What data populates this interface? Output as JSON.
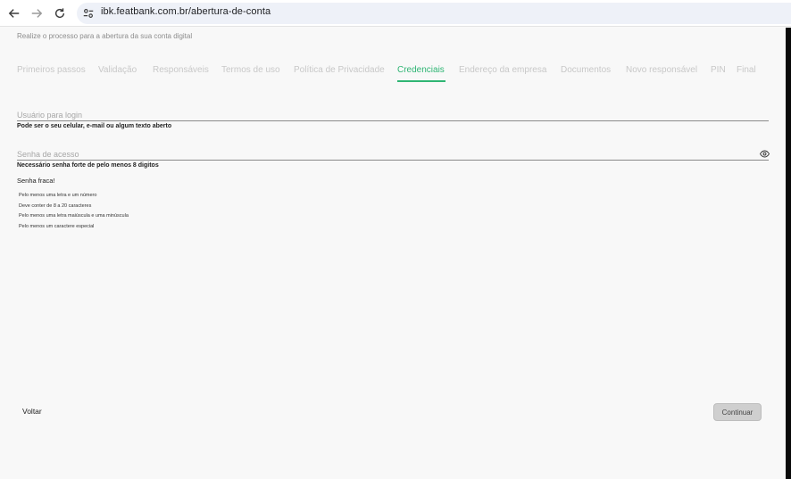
{
  "browser": {
    "url": "ibk.featbank.com.br/abertura-de-conta"
  },
  "page": {
    "subtitle": "Realize o processo para a abertura da sua conta digital"
  },
  "tabs": [
    {
      "label": "Primeiros passos",
      "active": false
    },
    {
      "label": "Validação",
      "active": false
    },
    {
      "label": "Responsáveis",
      "active": false
    },
    {
      "label": "Termos de uso",
      "active": false
    },
    {
      "label": "Política de Privacidade",
      "active": false
    },
    {
      "label": "Credenciais",
      "active": true
    },
    {
      "label": "Endereço da empresa",
      "active": false
    },
    {
      "label": "Documentos",
      "active": false
    },
    {
      "label": "Novo responsável",
      "active": false
    },
    {
      "label": "PIN",
      "active": false
    },
    {
      "label": "Final",
      "active": false
    }
  ],
  "form": {
    "login": {
      "placeholder": "Usuário para login",
      "help": "Pode ser o seu celular, e-mail ou algum texto aberto"
    },
    "password": {
      "placeholder": "Senha de acesso",
      "help": "Necessário senha forte de pelo menos 8 digitos",
      "visibility_icon": "eye-icon"
    },
    "strength": "Senha fraca!",
    "rules": [
      "Pelo menos uma letra e um número",
      "Deve conter de 8 a 20 caracteres",
      "Pelo menos uma letra maiúscula e uma minúscula",
      "Pelo menos um caractere especial"
    ]
  },
  "actions": {
    "back_label": "Voltar",
    "continue_label": "Continuar"
  },
  "colors": {
    "accent": "#2fb574",
    "inactive_tab": "#c8c8c8",
    "button_disabled": "#cfcfcf"
  }
}
